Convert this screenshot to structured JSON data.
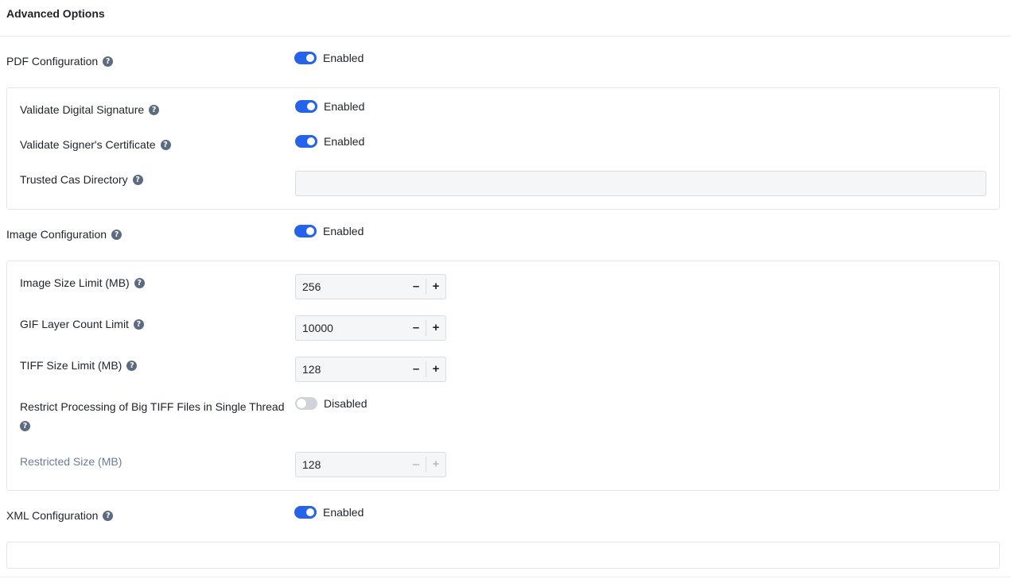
{
  "header": {
    "title": "Advanced Options"
  },
  "pdf": {
    "label": "PDF Configuration",
    "status": "Enabled",
    "validate_signature": {
      "label": "Validate Digital Signature",
      "status": "Enabled"
    },
    "validate_certificate": {
      "label": "Validate Signer's Certificate",
      "status": "Enabled"
    },
    "trusted_cas": {
      "label": "Trusted Cas Directory",
      "value": ""
    }
  },
  "image": {
    "label": "Image Configuration",
    "status": "Enabled",
    "size_limit": {
      "label": "Image Size Limit (MB)",
      "value": "256"
    },
    "gif_layers": {
      "label": "GIF Layer Count Limit",
      "value": "10000"
    },
    "tiff_size": {
      "label": "TIFF Size Limit (MB)",
      "value": "128"
    },
    "big_tiff": {
      "label": "Restrict Processing of Big TIFF Files in Single Thread",
      "status": "Disabled"
    },
    "restricted_size": {
      "label": "Restricted Size (MB)",
      "value": "128"
    }
  },
  "xml": {
    "label": "XML Configuration",
    "status": "Enabled"
  },
  "stepper_symbols": {
    "minus": "–",
    "plus": "+"
  },
  "help_symbol": "?",
  "colors": {
    "accent": "#2563eb",
    "toggle_off": "#d0d4da",
    "help_icon": "#5d6b82",
    "muted_text": "#6b7d94"
  }
}
